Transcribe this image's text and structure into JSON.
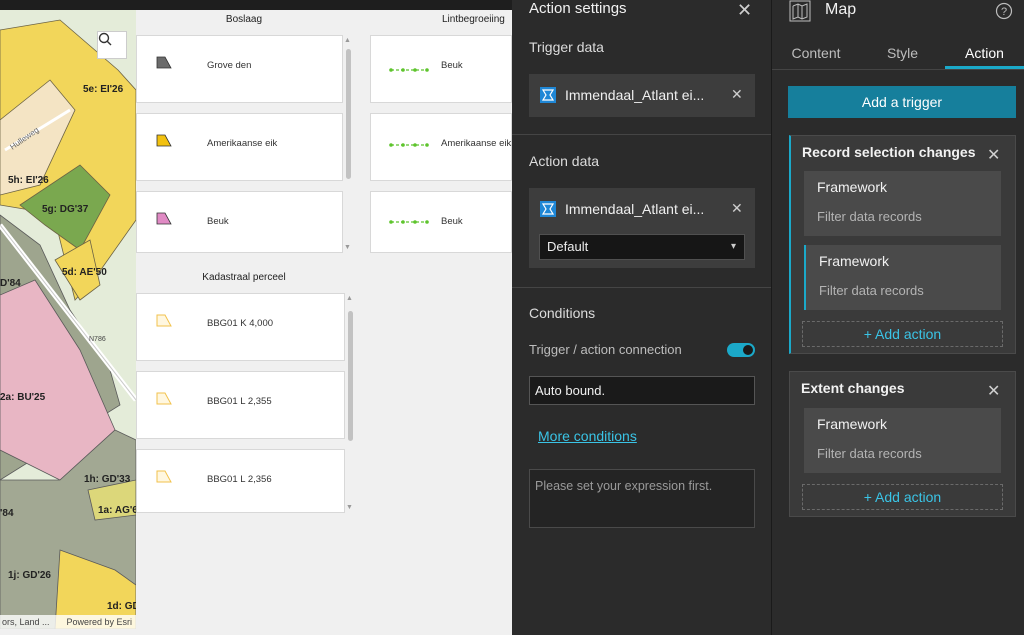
{
  "map": {
    "parcel_labels": [
      "5e: EI'26",
      "5h: EI'26",
      "5g: DG'37",
      "5d: AE'50",
      "D'84",
      "2a: BU'25",
      "1h: GD'33",
      "1a: AG'6",
      "'84",
      "1j: GD'26",
      "1d: GD"
    ],
    "road_labels": [
      "Hulleweg",
      "N786"
    ],
    "attribution_left": "ors, Land ...",
    "attribution_right": "Powered by Esri",
    "search_icon": "search-icon"
  },
  "legend": {
    "boslaag_title": "Boslaag",
    "boslaag_items": [
      {
        "label": "Grove den",
        "color": "#6b6b6b"
      },
      {
        "label": "Amerikaanse eik",
        "color": "#f2c10f"
      },
      {
        "label": "Beuk",
        "color": "#e08ac4"
      }
    ],
    "lint_title": "Lintbegroeiing",
    "lint_items": [
      {
        "label": "Beuk",
        "color": "#5ec42d"
      },
      {
        "label": "Amerikaanse eik",
        "color": "#5ec42d"
      },
      {
        "label": "Beuk",
        "color": "#5ec42d"
      }
    ],
    "kadaster_title": "Kadastraal perceel",
    "kadaster_items": [
      {
        "label": "BBG01 K 4,000",
        "color": "#f2c24c"
      },
      {
        "label": "BBG01 L 2,355",
        "color": "#f2c24c"
      },
      {
        "label": "BBG01 L 2,356",
        "color": "#f2c24c"
      }
    ]
  },
  "action_settings": {
    "title": "Action settings",
    "trigger_data_label": "Trigger data",
    "trigger_source": "Immendaal_Atlant ei...",
    "action_data_label": "Action data",
    "action_source": "Immendaal_Atlant ei...",
    "view_select": "Default",
    "conditions_label": "Conditions",
    "connection_label": "Trigger / action connection",
    "connection_on": true,
    "auto_bound": "Auto bound.",
    "more_conditions": "More conditions",
    "expression_placeholder": "Please set your expression first."
  },
  "map_panel": {
    "title": "Map",
    "tabs": [
      "Content",
      "Style",
      "Action"
    ],
    "active_tab": "Action",
    "add_trigger": "Add a trigger",
    "triggers": [
      {
        "title": "Record selection changes",
        "actions": [
          {
            "name": "Framework",
            "desc": "Filter data records"
          },
          {
            "name": "Framework",
            "desc": "Filter data records"
          }
        ],
        "add_action": "+ Add action"
      },
      {
        "title": "Extent changes",
        "actions": [
          {
            "name": "Framework",
            "desc": "Filter data records"
          }
        ],
        "add_action": "+ Add action"
      }
    ]
  },
  "colors": {
    "accent": "#1ba9c9",
    "button": "#167f9c",
    "panel": "#2b2b2b"
  }
}
